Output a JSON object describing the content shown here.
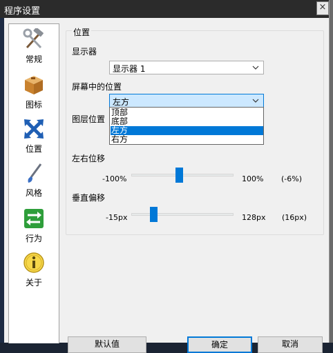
{
  "window": {
    "title": "程序设置",
    "close_glyph": "×"
  },
  "sidebar": {
    "items": [
      {
        "label": "常规",
        "icon": "tools-icon"
      },
      {
        "label": "图标",
        "icon": "box-icon"
      },
      {
        "label": "位置",
        "icon": "move-arrows-icon"
      },
      {
        "label": "风格",
        "icon": "brush-icon"
      },
      {
        "label": "行为",
        "icon": "swap-arrows-icon"
      },
      {
        "label": "关于",
        "icon": "info-icon"
      }
    ]
  },
  "position_group": {
    "title": "位置",
    "monitor_label": "显示器",
    "monitor_value": "显示器 1",
    "screen_position_label": "屏幕中的位置",
    "screen_position_value": "左方",
    "screen_position_options": [
      "顶部",
      "底部",
      "左方",
      "右方"
    ],
    "selected_option_index": 2,
    "layer_label": "图层位置",
    "horizontal": {
      "label": "左右位移",
      "min": "-100%",
      "max": "100%",
      "readout": "(-6%)",
      "value_fraction": 0.47
    },
    "vertical": {
      "label": "垂直偏移",
      "min": "-15px",
      "max": "128px",
      "readout": "(16px)",
      "value_fraction": 0.22
    }
  },
  "buttons": {
    "reset": "默认值",
    "ok": "确定",
    "cancel": "取消"
  },
  "colors": {
    "accent": "#0078d7",
    "titlebar": "#2b2b2b"
  }
}
